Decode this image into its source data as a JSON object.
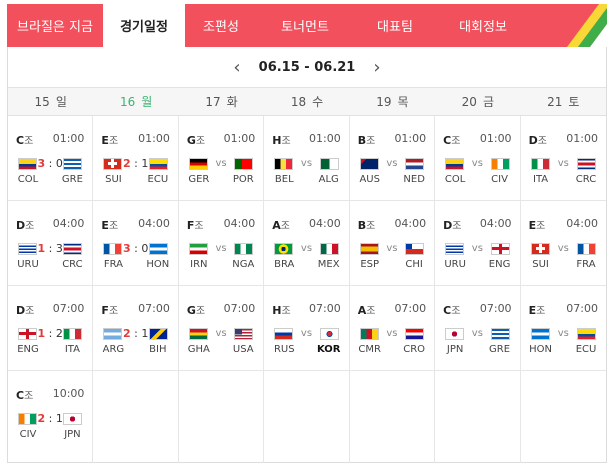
{
  "nav": {
    "tabs": [
      "브라질은 지금",
      "경기일정",
      "조편성",
      "토너먼트",
      "대표팀",
      "대회정보"
    ],
    "active": 1
  },
  "week": {
    "label": "06.15 - 06.21",
    "prev": "‹",
    "next": "›"
  },
  "days": [
    {
      "num": "15",
      "dow": "일"
    },
    {
      "num": "16",
      "dow": "월"
    },
    {
      "num": "17",
      "dow": "화"
    },
    {
      "num": "18",
      "dow": "수"
    },
    {
      "num": "19",
      "dow": "목"
    },
    {
      "num": "20",
      "dow": "금"
    },
    {
      "num": "21",
      "dow": "토"
    }
  ],
  "group_suffix": "조",
  "vs_label": "vs",
  "matches": [
    [
      {
        "group": "C",
        "time": "01:00",
        "home": "COL",
        "away": "GRE",
        "score": [
          "3",
          "0"
        ]
      },
      {
        "group": "E",
        "time": "01:00",
        "home": "SUI",
        "away": "ECU",
        "score": [
          "2",
          "1"
        ]
      },
      {
        "group": "G",
        "time": "01:00",
        "home": "GER",
        "away": "POR"
      },
      {
        "group": "H",
        "time": "01:00",
        "home": "BEL",
        "away": "ALG"
      },
      {
        "group": "B",
        "time": "01:00",
        "home": "AUS",
        "away": "NED"
      },
      {
        "group": "C",
        "time": "01:00",
        "home": "COL",
        "away": "CIV"
      },
      {
        "group": "D",
        "time": "01:00",
        "home": "ITA",
        "away": "CRC"
      }
    ],
    [
      {
        "group": "D",
        "time": "04:00",
        "home": "URU",
        "away": "CRC",
        "score": [
          "1",
          "3"
        ]
      },
      {
        "group": "E",
        "time": "04:00",
        "home": "FRA",
        "away": "HON",
        "score": [
          "3",
          "0"
        ]
      },
      {
        "group": "F",
        "time": "04:00",
        "home": "IRN",
        "away": "NGA"
      },
      {
        "group": "A",
        "time": "04:00",
        "home": "BRA",
        "away": "MEX"
      },
      {
        "group": "B",
        "time": "04:00",
        "home": "ESP",
        "away": "CHI"
      },
      {
        "group": "D",
        "time": "04:00",
        "home": "URU",
        "away": "ENG"
      },
      {
        "group": "E",
        "time": "04:00",
        "home": "SUI",
        "away": "FRA"
      }
    ],
    [
      {
        "group": "D",
        "time": "07:00",
        "home": "ENG",
        "away": "ITA",
        "score": [
          "1",
          "2"
        ]
      },
      {
        "group": "F",
        "time": "07:00",
        "home": "ARG",
        "away": "BIH",
        "score": [
          "2",
          "1"
        ]
      },
      {
        "group": "G",
        "time": "07:00",
        "home": "GHA",
        "away": "USA"
      },
      {
        "group": "H",
        "time": "07:00",
        "home": "RUS",
        "away": "KOR"
      },
      {
        "group": "A",
        "time": "07:00",
        "home": "CMR",
        "away": "CRO"
      },
      {
        "group": "C",
        "time": "07:00",
        "home": "JPN",
        "away": "GRE"
      },
      {
        "group": "E",
        "time": "07:00",
        "home": "HON",
        "away": "ECU"
      }
    ],
    [
      {
        "group": "C",
        "time": "10:00",
        "home": "CIV",
        "away": "JPN",
        "score": [
          "2",
          "1"
        ]
      }
    ]
  ],
  "colors": {
    "nav_bg": "#f2505c",
    "score": "#e03c3c",
    "today": "#3cb371"
  }
}
